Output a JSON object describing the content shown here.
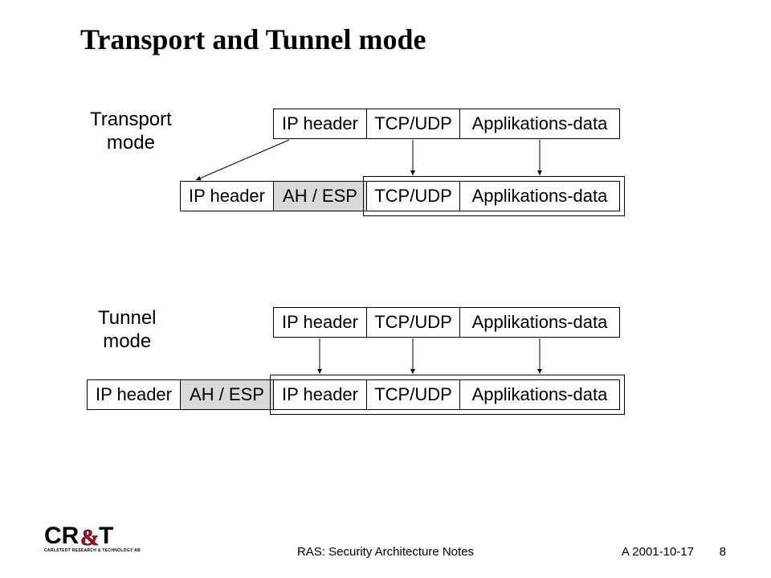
{
  "title": "Transport and Tunnel mode",
  "transport_label_l1": "Transport",
  "transport_label_l2": "mode",
  "tunnel_label_l1": "Tunnel",
  "tunnel_label_l2": "mode",
  "cells": {
    "ip_header": "IP header",
    "tcp_udp": "TCP/UDP",
    "app_data": "Applikations-data",
    "ah_esp": "AH / ESP"
  },
  "footer_center": "RAS: Security Architecture Notes",
  "footer_right": "A 2001-10-17",
  "footer_page": "8",
  "logo_text_cr": "CR",
  "logo_text_t": "T",
  "logo_sub": "CARLSTEDT RESEARCH & TECHNOLOGY AB"
}
